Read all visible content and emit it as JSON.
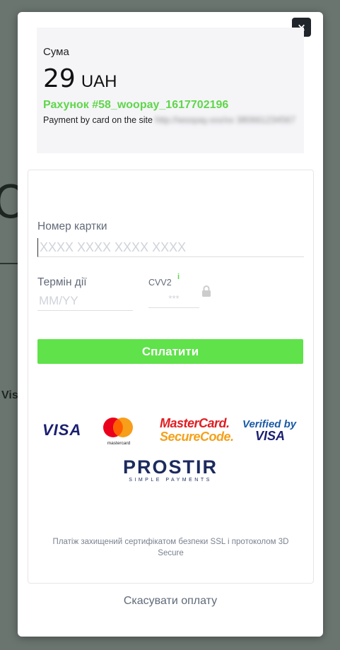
{
  "background": {
    "fragment_text": "O",
    "fragment_text_2": "Vis"
  },
  "modal": {
    "close_label": "×",
    "summary": {
      "sum_label": "Сума",
      "amount": "29",
      "currency": "UAH",
      "invoice": "Рахунок #58_woopay_1617702196",
      "description_prefix": "Payment by card on the site",
      "description_blurred": "http://woopay.xxx/xx 380661234567"
    },
    "form": {
      "card_number_label": "Номер картки",
      "card_number_placeholder": "XXXX XXXX XXXX XXXX",
      "expiry_label": "Термін дії",
      "expiry_placeholder": "MM/YY",
      "cvv_label": "CVV2",
      "cvv_info": "i",
      "cvv_placeholder": "***",
      "pay_label": "Сплатити"
    },
    "logos": {
      "visa": "VISA",
      "mastercard_caption": "mastercard",
      "mc_secure_1": "MasterCard.",
      "mc_secure_2": "SecureCode.",
      "verified_1": "Verified by",
      "verified_2": "VISA",
      "prostir": "PROSTIR",
      "prostir_sub": "SIMPLE PAYMENTS"
    },
    "security_text": "Платіж захищений сертифікатом безпеки SSL і протоколом 3D Secure",
    "cancel_label": "Скасувати оплату"
  },
  "colors": {
    "accent_green": "#5fe24a",
    "invoice_green": "#5fd64a",
    "overlay": "#6b7570"
  }
}
